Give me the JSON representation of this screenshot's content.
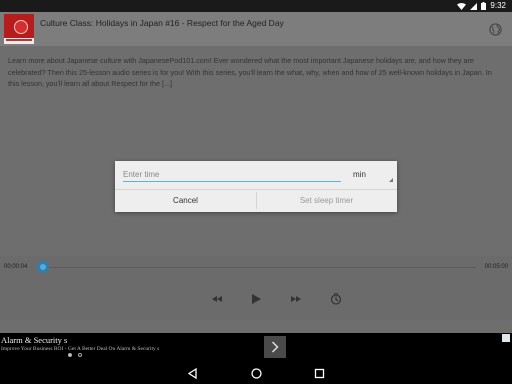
{
  "status_bar": {
    "time": "9:32"
  },
  "header": {
    "title": "Culture Class: Holidays in Japan #16 - Respect for the Aged Day",
    "thumbnail": "podcast-thumbnail",
    "globe_icon": "globe-icon"
  },
  "description": "Learn more about Japanese culture with JapanesePod101.com! Ever wondered what the most important Japanese holidays are, and how they are celebrated? Then this 25-lesson audio series is for you! With this series, you'll learn the what, why, when and how of 25 well-known holidays in Japan. In this lesson, you'll learn all about Respect for the [...]",
  "dialog": {
    "input_placeholder": "Enter time",
    "input_value": "",
    "unit_selected": "min",
    "cancel_label": "Cancel",
    "confirm_label": "Set sleep timer"
  },
  "player": {
    "elapsed": "00:00:04",
    "total": "00:05:00",
    "progress_fraction": 0.01,
    "controls": [
      "rewind-icon",
      "play-icon",
      "fast-forward-icon",
      "sleep-timer-icon"
    ]
  },
  "ad": {
    "title": "Alarm & Security s",
    "subtitle": "Improve Your Business ROI - Get A Better Deal On Alarm & Security s",
    "page_count": 2,
    "active_page": 0
  },
  "colors": {
    "accent": "#2e7fab",
    "input_underline": "#5bb3d6",
    "thumbnail_red": "#b71c1c"
  }
}
